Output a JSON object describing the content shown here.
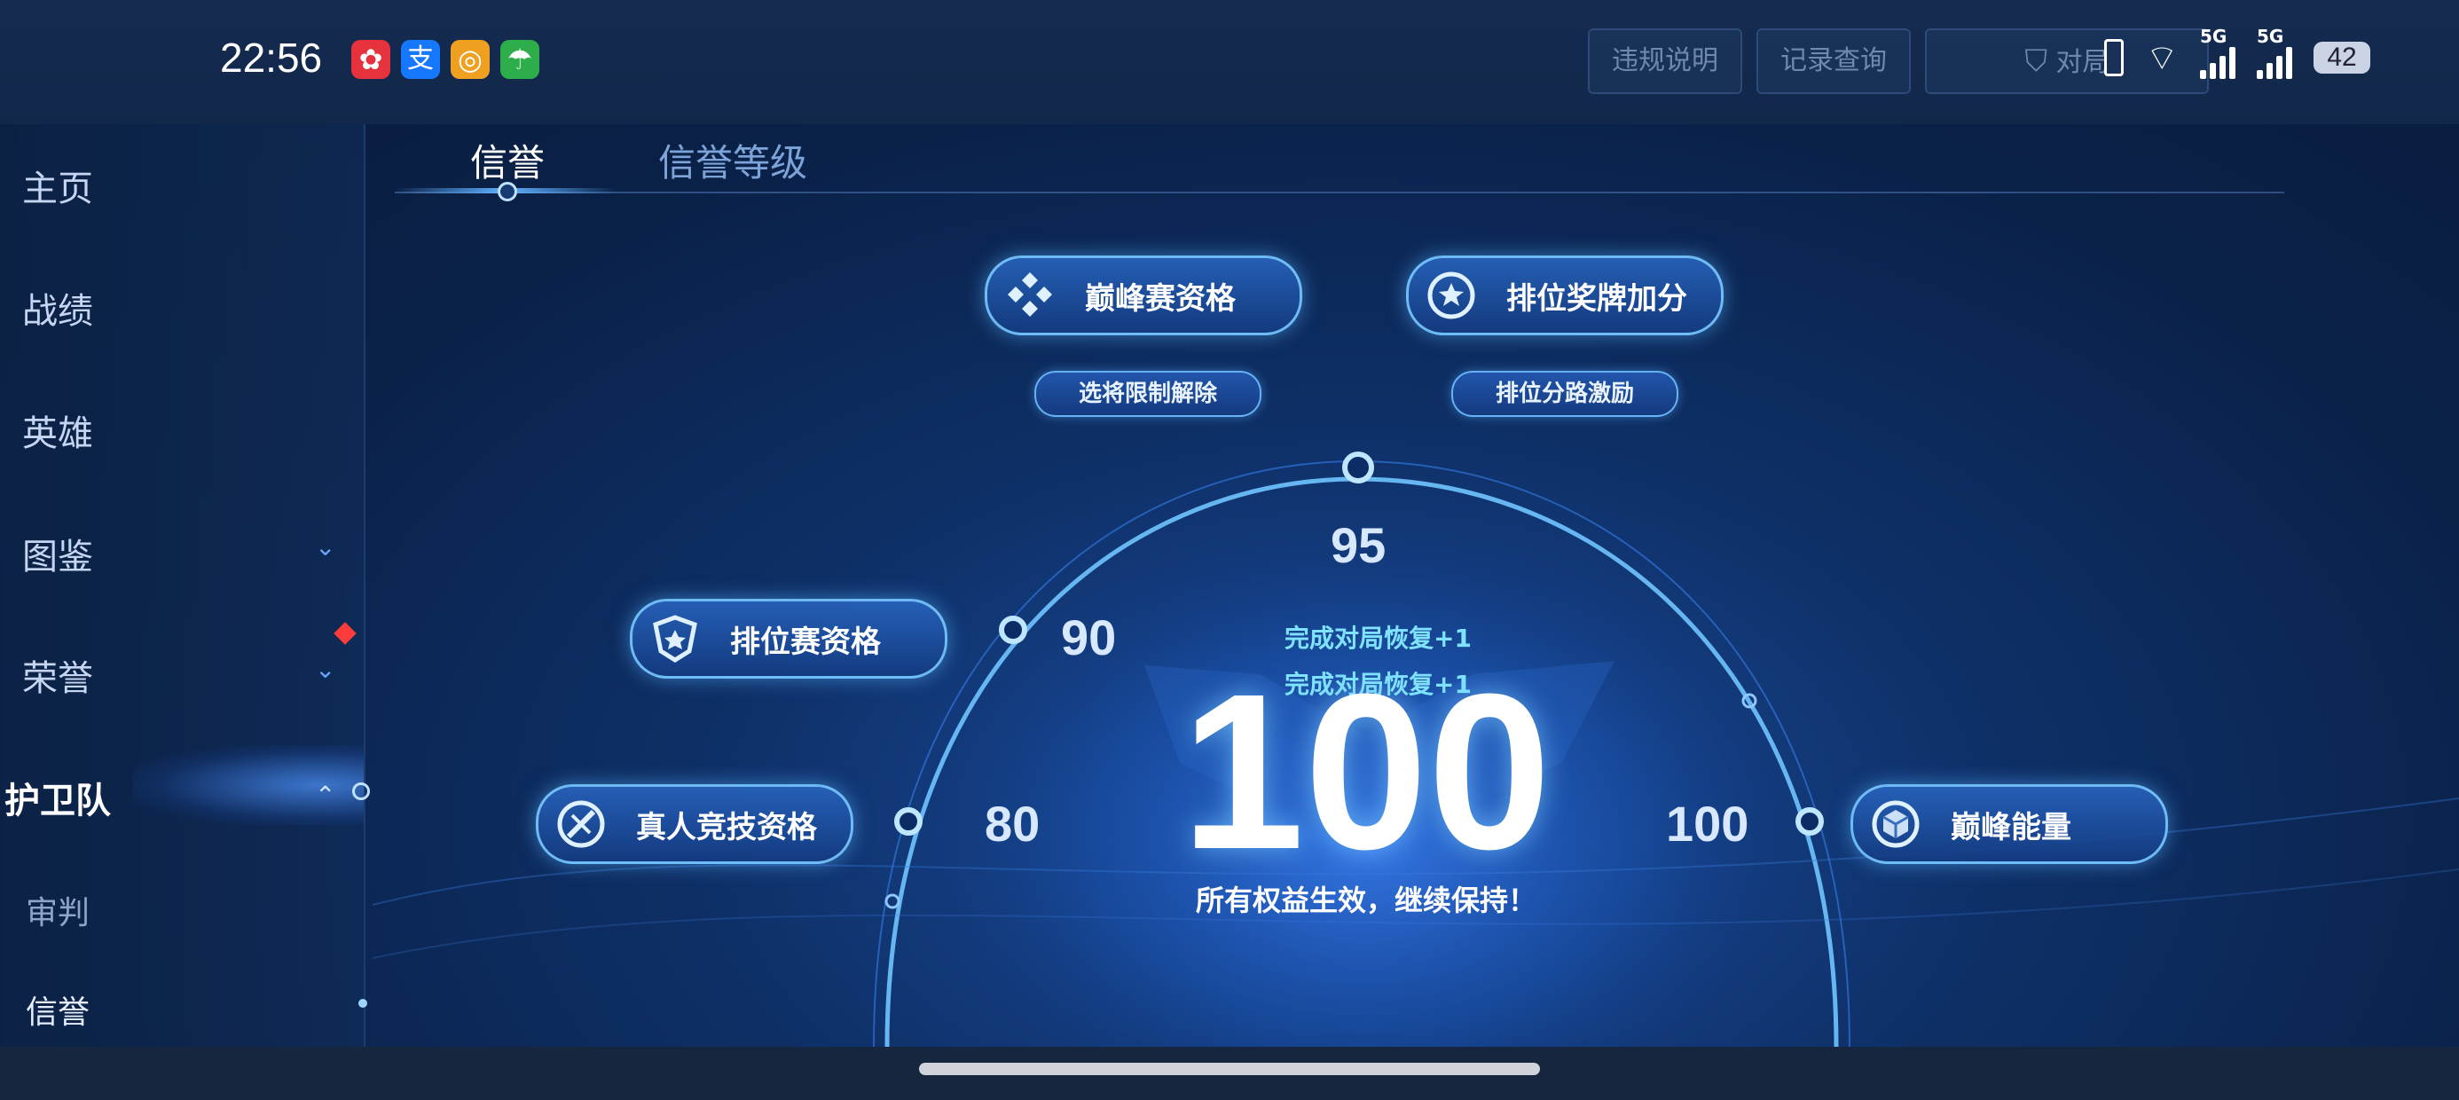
{
  "status_bar": {
    "time": "22:56",
    "apps": [
      {
        "icon": "bilibili-icon",
        "glyph": "✿",
        "color": "#e6323c"
      },
      {
        "icon": "alipay-icon",
        "glyph": "支",
        "color": "#1677ff"
      },
      {
        "icon": "target-app-icon",
        "glyph": "◎",
        "color": "#f0a020"
      },
      {
        "icon": "umbrella-app-icon",
        "glyph": "☂",
        "color": "#2eae4a"
      }
    ],
    "network_labels": [
      "5G",
      "5G"
    ],
    "battery": "42"
  },
  "top_buttons": [
    "违规说明",
    "记录查询",
    "对局"
  ],
  "sidebar": {
    "items": [
      {
        "label": "主页"
      },
      {
        "label": "战绩"
      },
      {
        "label": "英雄"
      },
      {
        "label": "图鉴"
      },
      {
        "label": "荣誉"
      },
      {
        "label": "护卫队"
      },
      {
        "label": "审判"
      },
      {
        "label": "信誉"
      }
    ]
  },
  "tabs": [
    {
      "label": "信誉"
    },
    {
      "label": "信誉等级"
    }
  ],
  "privileges": {
    "peak_match": "巅峰赛资格",
    "rank_medal": "排位奖牌加分",
    "pick_unlock": "选将限制解除",
    "lane_bonus": "排位分路激励",
    "ranked_match": "排位赛资格",
    "human_match": "真人竞技资格",
    "peak_energy": "巅峰能量"
  },
  "gauge": {
    "ticks": [
      "80",
      "90",
      "95",
      "100"
    ],
    "hint1": "完成对局恢复+1",
    "hint2": "完成对局恢复+1",
    "score": "100",
    "status": "所有权益生效，继续保持！"
  },
  "colors": {
    "accent": "#5fb0ff",
    "glow": "#7fe3ff",
    "alert": "#ff3b3b"
  }
}
